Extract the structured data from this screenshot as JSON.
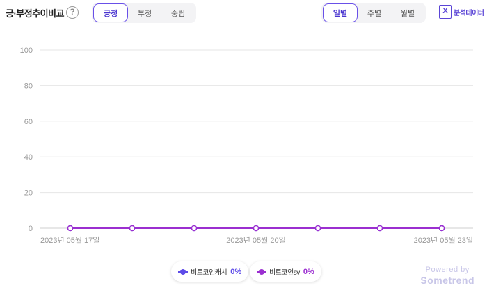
{
  "header": {
    "title": "긍·부정추이비교",
    "help_icon": "?",
    "sentiment_tabs": [
      {
        "label": "긍정",
        "active": true
      },
      {
        "label": "부정",
        "active": false
      },
      {
        "label": "중립",
        "active": false
      }
    ],
    "period_tabs": [
      {
        "label": "일별",
        "active": true
      },
      {
        "label": "주별",
        "active": false
      },
      {
        "label": "월별",
        "active": false
      }
    ],
    "excel": {
      "icon": "X",
      "label": "분석데이터"
    }
  },
  "chart_data": {
    "type": "line",
    "x": [
      "2023-05-17",
      "2023-05-18",
      "2023-05-19",
      "2023-05-20",
      "2023-05-21",
      "2023-05-22",
      "2023-05-23"
    ],
    "x_tick_labels": [
      "2023년 05월 17일",
      "2023년 05월 20일",
      "2023년 05월 23일"
    ],
    "y_ticks": [
      "100",
      "80",
      "60",
      "40",
      "20",
      "0"
    ],
    "ylim": [
      0,
      100
    ],
    "grid": true,
    "legend_position": "bottom",
    "series": [
      {
        "name": "비트코인캐시",
        "values": [
          0,
          0,
          0,
          0,
          0,
          0,
          0
        ],
        "total": "0%",
        "color": "#5d4be8"
      },
      {
        "name": "비트코인sv",
        "values": [
          0,
          0,
          0,
          0,
          0,
          0,
          0
        ],
        "total": "0%",
        "color": "#9b2fd0"
      }
    ]
  },
  "powered": {
    "by": "Powered by",
    "brand": "Sometrend"
  }
}
